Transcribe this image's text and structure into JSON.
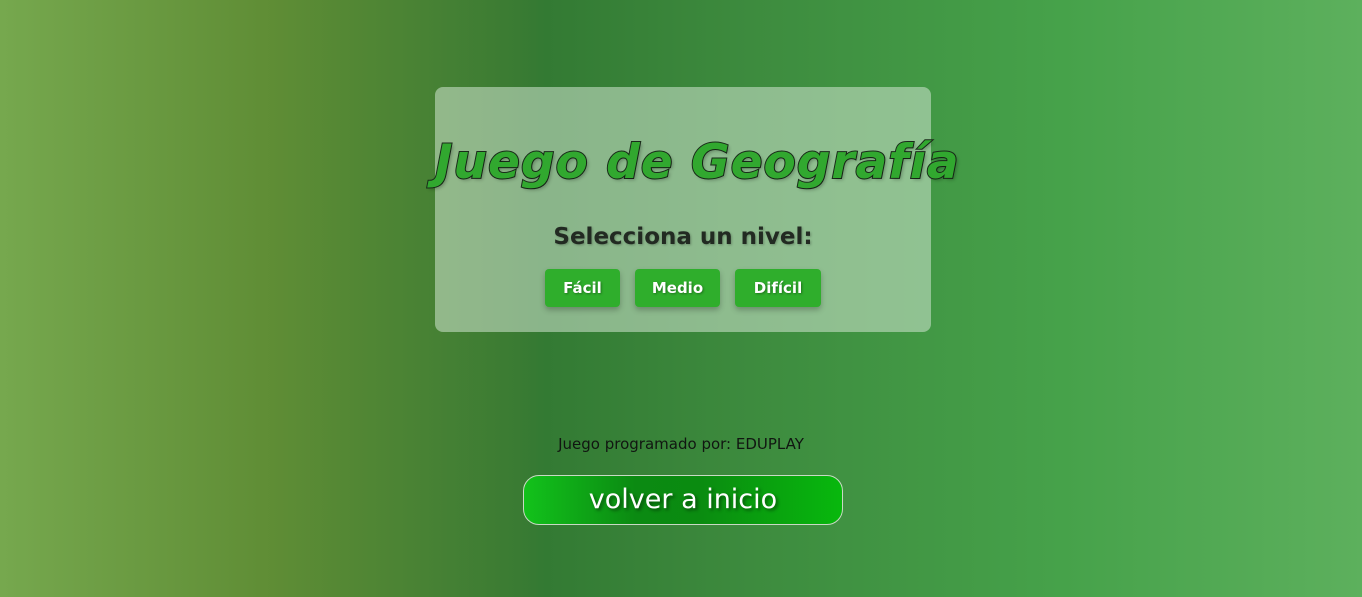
{
  "game": {
    "title": "Juego de Geografía",
    "subtitle": "Selecciona un nivel:",
    "levels": [
      {
        "label": "Fácil"
      },
      {
        "label": "Medio"
      },
      {
        "label": "Difícil"
      }
    ]
  },
  "footer": {
    "credit": "Juego programado por: EDUPLAY",
    "home_button_label": "volver a inicio"
  },
  "colors": {
    "panel_bg": "#d2e6d2",
    "title_fill": "#31a82f",
    "level_button_bg": "#2fae2c",
    "home_button_bg": "#0a8b10"
  }
}
